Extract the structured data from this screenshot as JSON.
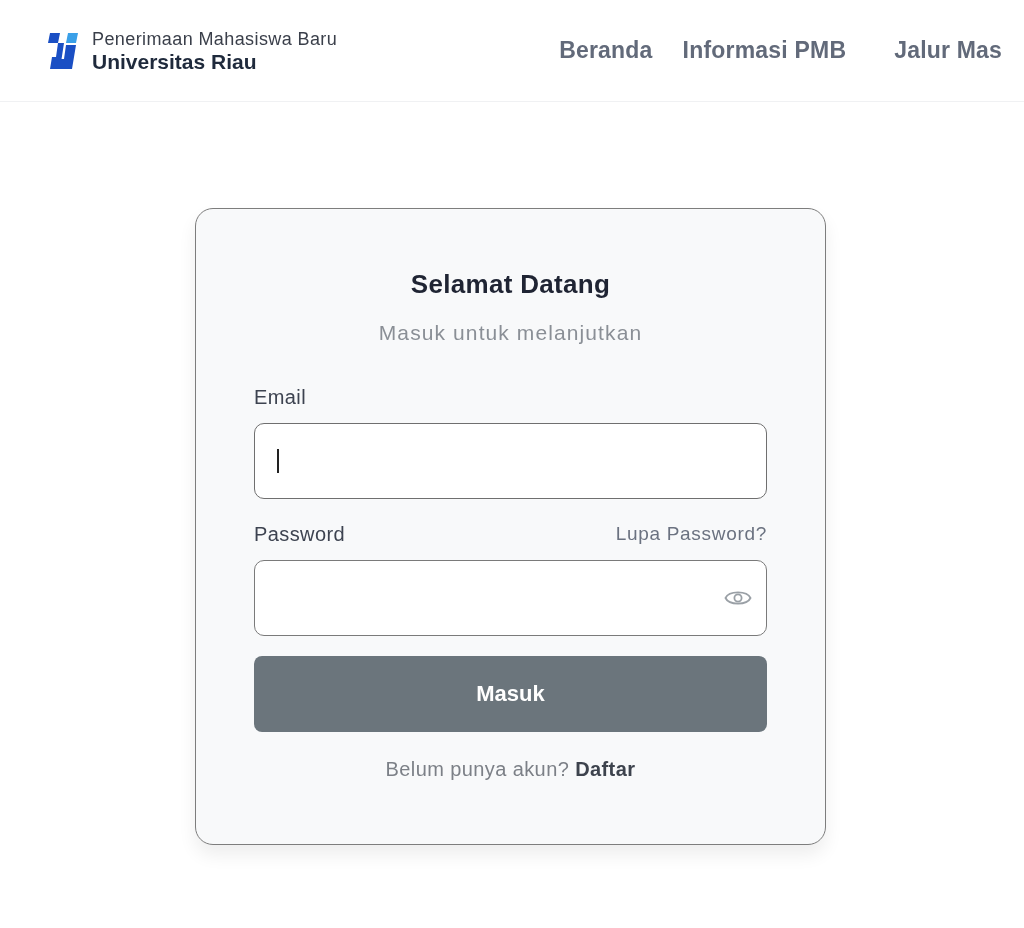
{
  "header": {
    "logo": {
      "subtitle": "Penerimaan Mahasiswa Baru",
      "title": "Universitas Riau"
    },
    "nav": [
      {
        "label": "Beranda"
      },
      {
        "label": "Informasi PMB"
      },
      {
        "label": "Jalur Mas"
      }
    ]
  },
  "login_card": {
    "title": "Selamat Datang",
    "subtitle": "Masuk untuk melanjutkan",
    "fields": [
      {
        "kind": "email",
        "label": "Email",
        "focused": true
      },
      {
        "kind": "password",
        "label": "Password",
        "link": "Lupa Password?",
        "focused": false
      }
    ],
    "submit": "Masuk",
    "signup": {
      "prompt": "Belum punya akun?",
      "link": "Daftar"
    }
  }
}
